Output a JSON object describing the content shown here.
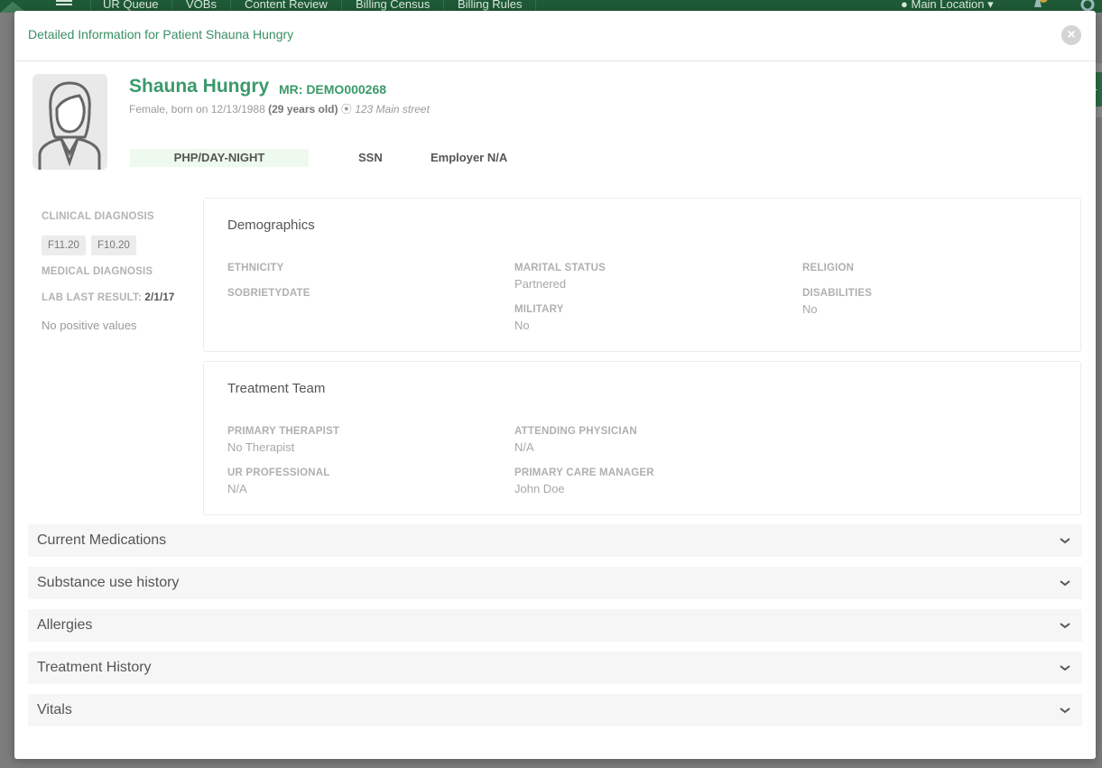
{
  "background_app": {
    "nav_items": [
      "UR Queue",
      "VOBs",
      "Content Review",
      "Billing Census",
      "Billing Rules"
    ],
    "location": "Main Location"
  },
  "modal": {
    "title": "Detailed Information for Patient Shauna Hungry",
    "close_icon": "close-circle-icon"
  },
  "patient": {
    "name": "Shauna Hungry",
    "mr": "MR: DEMO000268",
    "gender_born": "Female, born on 12/13/1988",
    "age": "(29 years old)",
    "address": "123 Main street",
    "program": "PHP/DAY-NIGHT",
    "ssn": "SSN",
    "employer": "Employer N/A"
  },
  "sidebar": {
    "clinical_diagnosis_label": "CLINICAL DIAGNOSIS",
    "clinical_codes": [
      "F11.20",
      "F10.20"
    ],
    "medical_diagnosis_label": "MEDICAL DIAGNOSIS",
    "lab_last_result_label": "LAB LAST RESULT:",
    "lab_last_result_value": "2/1/17",
    "lab_note": "No positive values"
  },
  "demographics": {
    "title": "Demographics",
    "ethnicity_label": "ETHNICITY",
    "sobriety_label": "SOBRIETYDATE",
    "marital_label": "MARITAL STATUS",
    "marital_value": "Partnered",
    "military_label": "MILITARY",
    "military_value": "No",
    "religion_label": "RELIGION",
    "disabilities_label": "DISABILITIES",
    "disabilities_value": "No"
  },
  "treatment_team": {
    "title": "Treatment Team",
    "primary_therapist_label": "PRIMARY THERAPIST",
    "primary_therapist_value": "No Therapist",
    "ur_professional_label": "UR PROFESSIONAL",
    "ur_professional_value": "N/A",
    "attending_physician_label": "ATTENDING PHYSICIAN",
    "attending_physician_value": "N/A",
    "primary_care_manager_label": "PRIMARY CARE MANAGER",
    "primary_care_manager_value": "John Doe"
  },
  "accordions": [
    {
      "label": "Current Medications"
    },
    {
      "label": "Substance use history"
    },
    {
      "label": "Allergies"
    },
    {
      "label": "Treatment History"
    },
    {
      "label": "Vitals"
    }
  ],
  "colors": {
    "accent_green": "#3a9a6a",
    "topbar": "#1f5a37",
    "overlay": "#7c7c7c"
  }
}
